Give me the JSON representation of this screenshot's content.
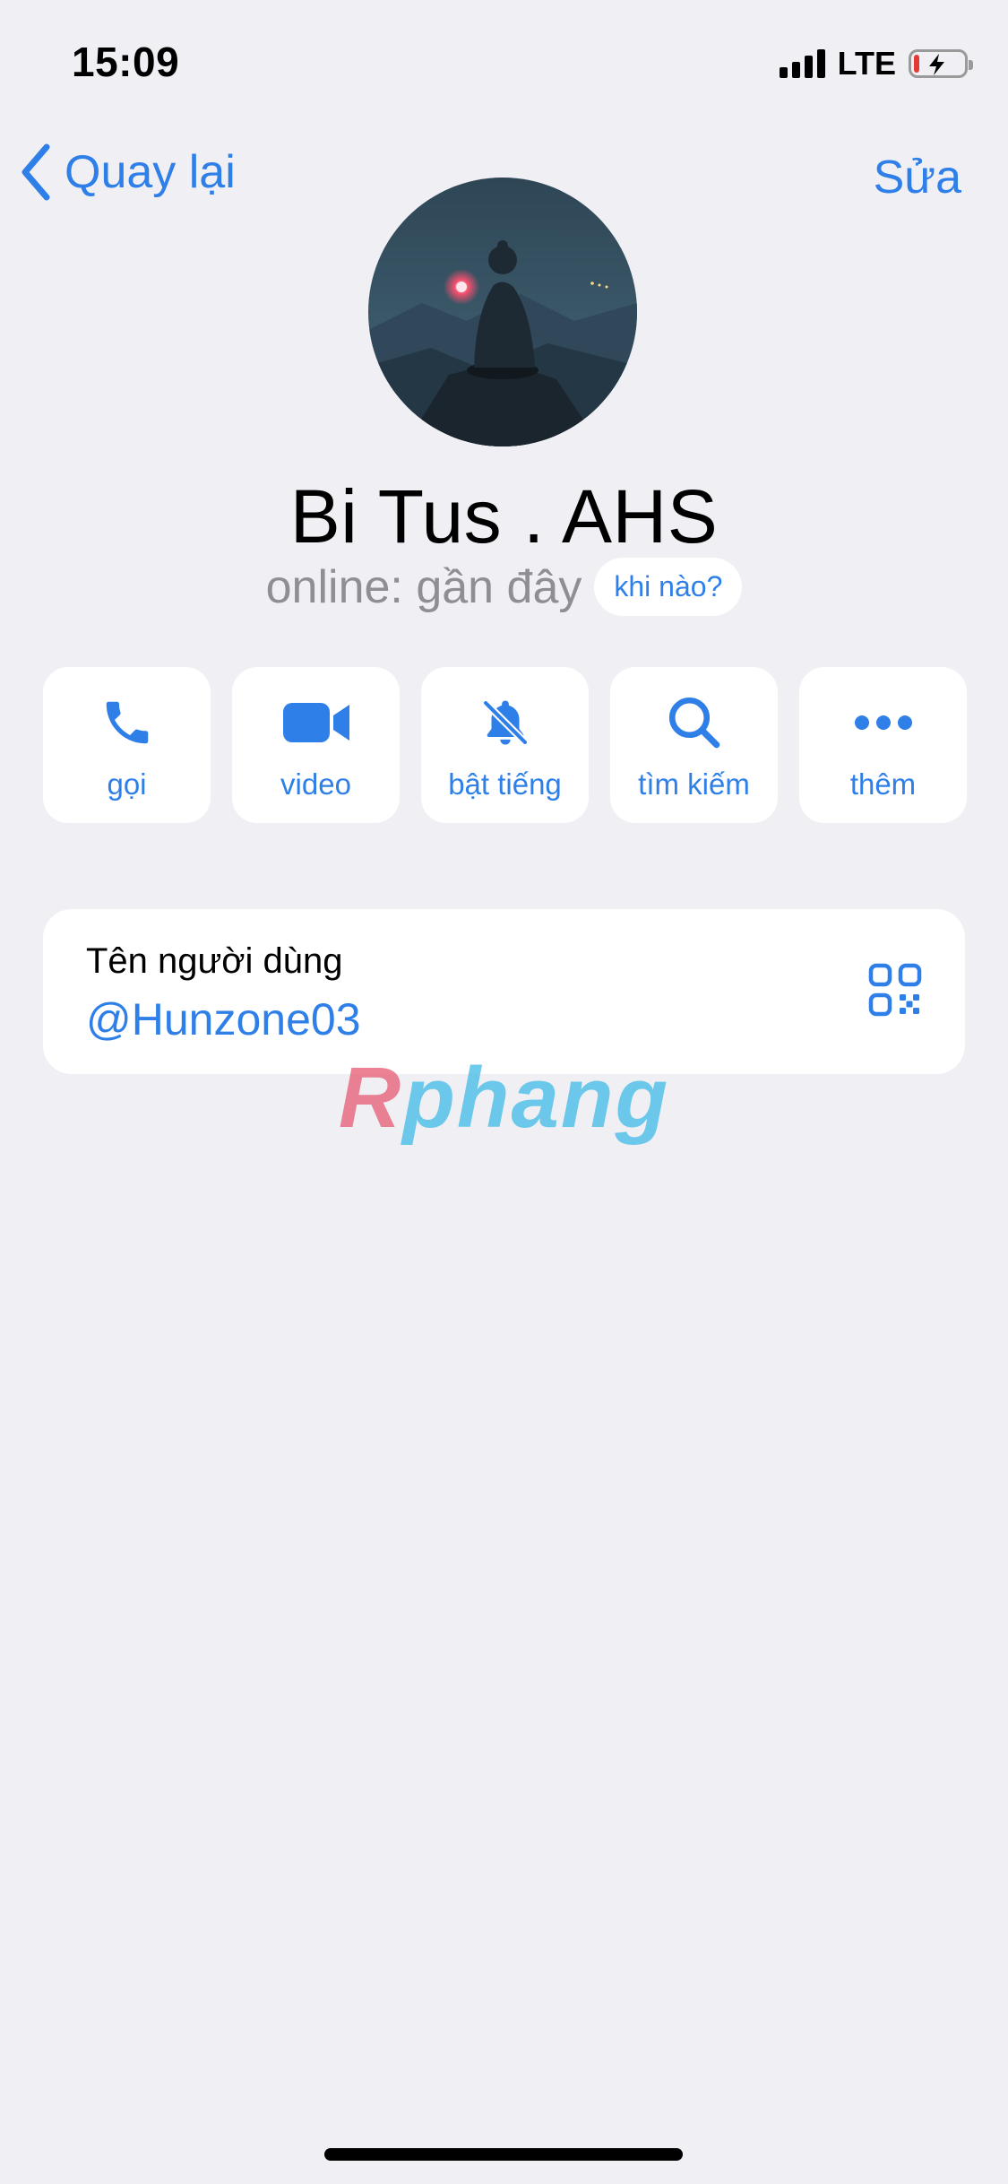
{
  "status_bar": {
    "time": "15:09",
    "network": "LTE",
    "battery_level": 0.12
  },
  "nav": {
    "back_label": "Quay lại",
    "edit_label": "Sửa"
  },
  "profile": {
    "name": "Bi Tus . AHS",
    "last_seen": "online: gần đây",
    "when_chip": "khi nào?"
  },
  "actions": [
    {
      "label": "gọi",
      "icon": "phone-icon"
    },
    {
      "label": "video",
      "icon": "video-camera-icon"
    },
    {
      "label": "bật tiếng",
      "icon": "bell-slash-icon"
    },
    {
      "label": "tìm kiếm",
      "icon": "search-icon"
    },
    {
      "label": "thêm",
      "icon": "more-dots-icon"
    }
  ],
  "username_card": {
    "caption": "Tên người dùng",
    "value": "@Hunzone03",
    "qr_icon": "qr-code-icon"
  },
  "watermark": {
    "part1": "R",
    "part2": "phang"
  },
  "colors": {
    "accent": "#2F7FE8",
    "background": "#EFEFF4",
    "secondary_text": "#8E8E93"
  }
}
